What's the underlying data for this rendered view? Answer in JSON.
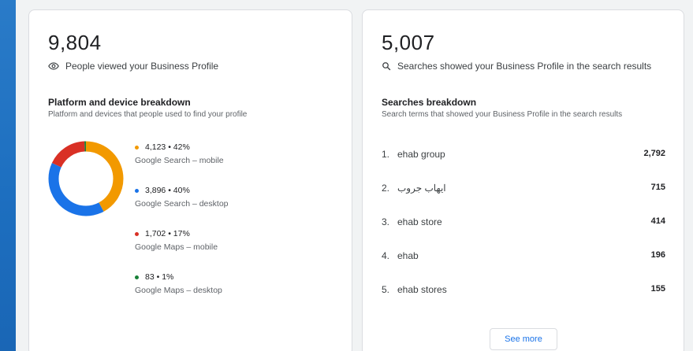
{
  "left_card": {
    "views_count": "9,804",
    "views_label": "People viewed your Business Profile",
    "breakdown_title": "Platform and device breakdown",
    "breakdown_subtitle": "Platform and devices that people used to find your profile",
    "platforms": [
      {
        "stat": "4,123 • 42%",
        "label": "Google Search – mobile",
        "value": 4123,
        "color": "#f29900"
      },
      {
        "stat": "3,896 • 40%",
        "label": "Google Search – desktop",
        "value": 3896,
        "color": "#1a73e8"
      },
      {
        "stat": "1,702 • 17%",
        "label": "Google Maps – mobile",
        "value": 1702,
        "color": "#d93025"
      },
      {
        "stat": "83 • 1%",
        "label": "Google Maps – desktop",
        "value": 83,
        "color": "#188038"
      }
    ]
  },
  "right_card": {
    "searches_count": "5,007",
    "searches_label": "Searches showed your Business Profile in the search results",
    "breakdown_title": "Searches breakdown",
    "breakdown_subtitle": "Search terms that showed your Business Profile in the search results",
    "terms": [
      {
        "rank": "1.",
        "term": "ehab group",
        "count": "2,792"
      },
      {
        "rank": "2.",
        "term": "ايهاب جروب",
        "count": "715"
      },
      {
        "rank": "3.",
        "term": "ehab store",
        "count": "414"
      },
      {
        "rank": "4.",
        "term": "ehab",
        "count": "196"
      },
      {
        "rank": "5.",
        "term": "ehab stores",
        "count": "155"
      }
    ],
    "see_more_label": "See more"
  },
  "icons": {
    "views": "eye-icon",
    "searches": "search-icon"
  }
}
